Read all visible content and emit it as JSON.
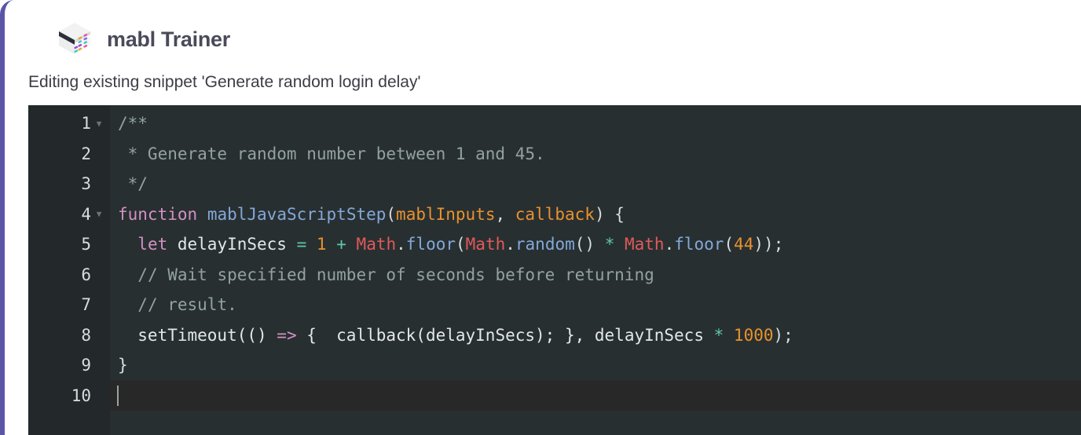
{
  "window": {
    "accent_border_color": "#5b55a8",
    "background": "#ffffff"
  },
  "header": {
    "logo_icon": "mabl-cube-logo-icon",
    "title": "mabl Trainer"
  },
  "subtitle": {
    "text": "Editing existing snippet 'Generate random login delay'"
  },
  "editor": {
    "background": "#282f31",
    "gutter_background": "#23282a",
    "active_line_background": "#282828",
    "cursor_line": 10,
    "cursor_column": 1,
    "language": "javascript",
    "fold_icon": "chevron-down-icon",
    "lines": [
      {
        "number": "1",
        "foldable": true,
        "text": "/**",
        "tokens": [
          {
            "t": "/**",
            "c": "t-comment"
          }
        ]
      },
      {
        "number": "2",
        "foldable": false,
        "text": " * Generate random number between 1 and 45.",
        "tokens": [
          {
            "t": " * Generate random number between 1 and 45.",
            "c": "t-comment"
          }
        ]
      },
      {
        "number": "3",
        "foldable": false,
        "text": " */",
        "tokens": [
          {
            "t": " */",
            "c": "t-comment"
          }
        ]
      },
      {
        "number": "4",
        "foldable": true,
        "text": "function mablJavaScriptStep(mablInputs, callback) {",
        "tokens": [
          {
            "t": "function",
            "c": "t-keyword"
          },
          {
            "t": " ",
            "c": "t-plain"
          },
          {
            "t": "mablJavaScriptStep",
            "c": "t-func"
          },
          {
            "t": "(",
            "c": "t-punct"
          },
          {
            "t": "mablInputs",
            "c": "t-param"
          },
          {
            "t": ", ",
            "c": "t-punct"
          },
          {
            "t": "callback",
            "c": "t-param"
          },
          {
            "t": ") {",
            "c": "t-punct"
          }
        ]
      },
      {
        "number": "5",
        "foldable": false,
        "text": "  let delayInSecs = 1 + Math.floor(Math.random() * Math.floor(44));",
        "tokens": [
          {
            "t": "  ",
            "c": "t-plain"
          },
          {
            "t": "let",
            "c": "t-keyword"
          },
          {
            "t": " delayInSecs ",
            "c": "t-plain"
          },
          {
            "t": "=",
            "c": "t-op"
          },
          {
            "t": " ",
            "c": "t-plain"
          },
          {
            "t": "1",
            "c": "t-num"
          },
          {
            "t": " ",
            "c": "t-plain"
          },
          {
            "t": "+",
            "c": "t-op"
          },
          {
            "t": " ",
            "c": "t-plain"
          },
          {
            "t": "Math",
            "c": "t-obj"
          },
          {
            "t": ".",
            "c": "t-punct"
          },
          {
            "t": "floor",
            "c": "t-method"
          },
          {
            "t": "(",
            "c": "t-punct"
          },
          {
            "t": "Math",
            "c": "t-obj"
          },
          {
            "t": ".",
            "c": "t-punct"
          },
          {
            "t": "random",
            "c": "t-method"
          },
          {
            "t": "() ",
            "c": "t-punct"
          },
          {
            "t": "*",
            "c": "t-op"
          },
          {
            "t": " ",
            "c": "t-plain"
          },
          {
            "t": "Math",
            "c": "t-obj"
          },
          {
            "t": ".",
            "c": "t-punct"
          },
          {
            "t": "floor",
            "c": "t-method"
          },
          {
            "t": "(",
            "c": "t-punct"
          },
          {
            "t": "44",
            "c": "t-num"
          },
          {
            "t": "));",
            "c": "t-punct"
          }
        ]
      },
      {
        "number": "6",
        "foldable": false,
        "text": "  // Wait specified number of seconds before returning",
        "tokens": [
          {
            "t": "  ",
            "c": "t-plain"
          },
          {
            "t": "// Wait specified number of seconds before returning",
            "c": "t-comment"
          }
        ]
      },
      {
        "number": "7",
        "foldable": false,
        "text": "  // result.",
        "tokens": [
          {
            "t": "  ",
            "c": "t-plain"
          },
          {
            "t": "// result.",
            "c": "t-comment"
          }
        ]
      },
      {
        "number": "8",
        "foldable": false,
        "text": "  setTimeout(() => {  callback(delayInSecs); }, delayInSecs * 1000);",
        "tokens": [
          {
            "t": "  setTimeout(() ",
            "c": "t-plain"
          },
          {
            "t": "=>",
            "c": "t-arrow"
          },
          {
            "t": " {  callback(delayInSecs); }, delayInSecs ",
            "c": "t-plain"
          },
          {
            "t": "*",
            "c": "t-op"
          },
          {
            "t": " ",
            "c": "t-plain"
          },
          {
            "t": "1000",
            "c": "t-num"
          },
          {
            "t": ");",
            "c": "t-punct"
          }
        ]
      },
      {
        "number": "9",
        "foldable": false,
        "text": "}",
        "tokens": [
          {
            "t": "}",
            "c": "t-punct"
          }
        ]
      },
      {
        "number": "10",
        "foldable": false,
        "active": true,
        "text": "",
        "tokens": []
      }
    ]
  }
}
